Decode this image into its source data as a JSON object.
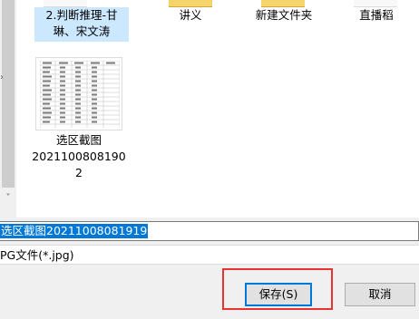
{
  "files": [
    {
      "name": "2.判断推理-甘\n琳、宋文涛",
      "selected": true
    },
    {
      "name": "讲义",
      "selected": false
    },
    {
      "name": "新建文件夹",
      "selected": false
    },
    {
      "name": "直播稻",
      "selected": false
    },
    {
      "name": "选区截图\n2021100808190\n2",
      "selected": false
    }
  ],
  "save_form": {
    "filename_value": "选区截图20211008081919",
    "filetype_value": "PG文件(*.jpg)"
  },
  "buttons": {
    "save_label": "保存(S)",
    "cancel_label": "取消"
  },
  "annotation": {
    "highlight_color": "#e8332e"
  }
}
